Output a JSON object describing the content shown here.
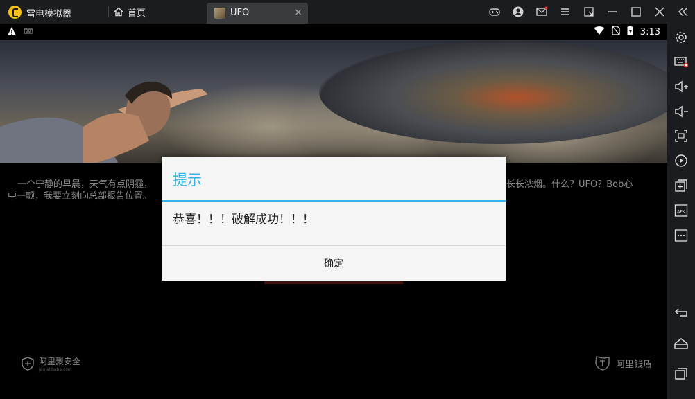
{
  "titlebar": {
    "app_name": "雷电模拟器",
    "home_tab_label": "首页",
    "active_tab_label": "UFO",
    "close_glyph": "×",
    "icons": [
      "gamepad-icon",
      "user-icon",
      "mail-icon",
      "menu-icon",
      "shrink-icon",
      "minimize-icon",
      "maximize-icon",
      "close-icon",
      "collapse-sidebar-icon"
    ]
  },
  "statusbar": {
    "time": "3:13",
    "icons": [
      "warning-icon",
      "keyboard-icon",
      "wifi-icon",
      "no-sim-icon",
      "battery-icon"
    ]
  },
  "sidebar": {
    "items": [
      "settings-icon",
      "keymap-icon",
      "volume-up-icon",
      "volume-down-icon",
      "fullscreen-icon",
      "record-icon",
      "add-app-icon",
      "apk-install-icon",
      "more-icon",
      "back-icon",
      "home-icon",
      "recent-apps-icon"
    ],
    "apk_label": "APK"
  },
  "game": {
    "story_line1": "一个宁静的早晨，天气有点阴霾，",
    "story_line1_right": "随着长长浓烟。什么？UFO？Bob心",
    "story_line2": "中一颤，我要立刻向总部报告位置。",
    "brand_left": "阿里聚安全",
    "brand_left_sub": "jaq.alibaba.com",
    "brand_right": "阿里钱盾"
  },
  "dialog": {
    "title": "提示",
    "message": "恭喜！！！破解成功！！！",
    "ok_button": "确定"
  },
  "colors": {
    "accent": "#33b5e5",
    "titlebar_bg": "#1b1c1f",
    "logo": "#f7c21b"
  }
}
